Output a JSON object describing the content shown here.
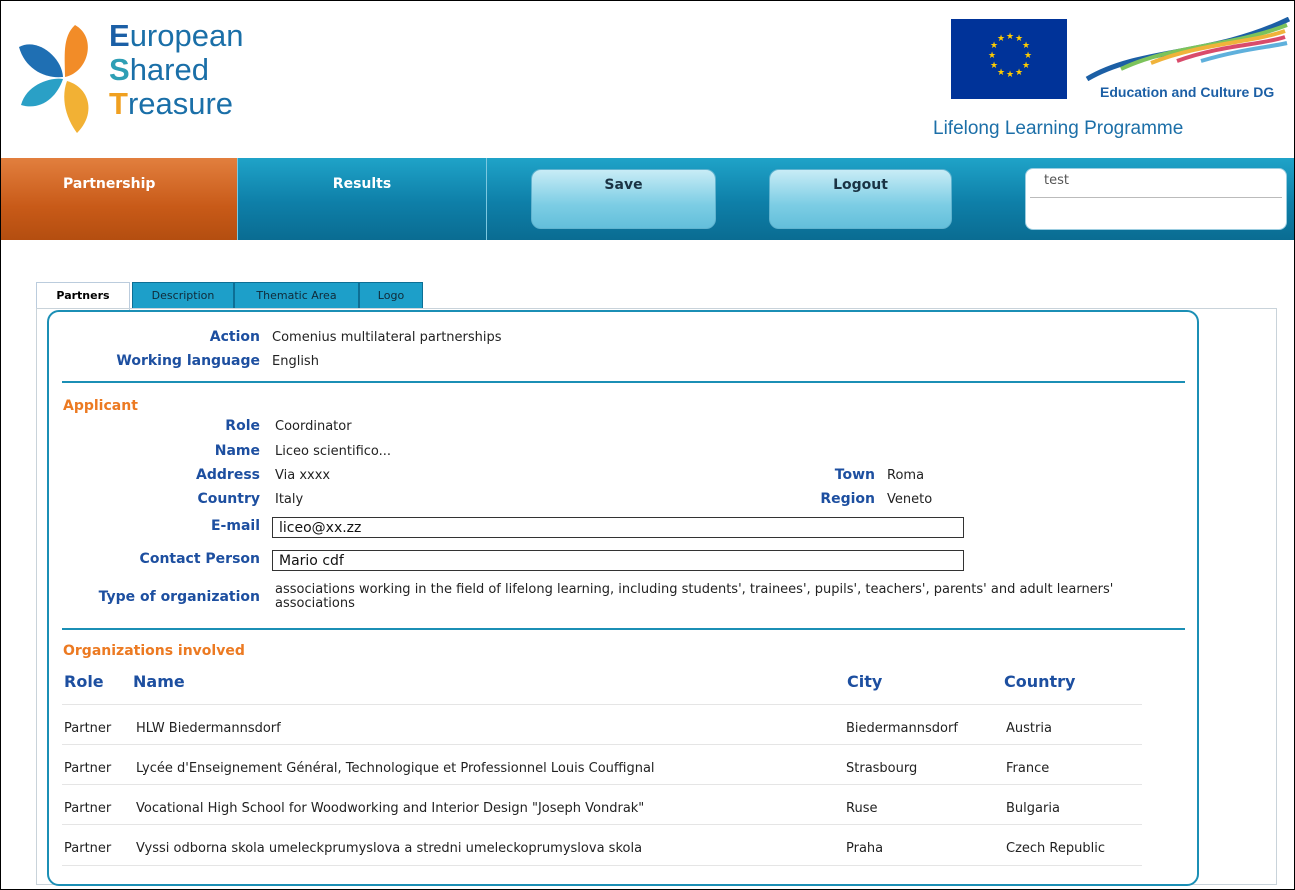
{
  "header": {
    "logo_words": [
      {
        "cap": "E",
        "rest": "uropean"
      },
      {
        "cap": "S",
        "rest": "hared"
      },
      {
        "cap": "T",
        "rest": "reasure"
      }
    ],
    "partner_name": "Education and Culture DG",
    "programme": "Lifelong Learning Programme"
  },
  "nav": {
    "partnership": "Partnership",
    "results": "Results",
    "save": "Save",
    "logout": "Logout",
    "user_value": "test"
  },
  "tabs": [
    "Partners",
    "Description",
    "Thematic Area",
    "Logo"
  ],
  "summary": {
    "action_label": "Action",
    "action_value": "Comenius multilateral partnerships",
    "language_label": "Working language",
    "language_value": "English"
  },
  "applicant": {
    "section_title": "Applicant",
    "role_label": "Role",
    "role_value": "Coordinator",
    "name_label": "Name",
    "name_value": "Liceo scientifico...",
    "address_label": "Address",
    "address_value": "Via xxxx",
    "town_label": "Town",
    "town_value": "Roma",
    "country_label": "Country",
    "country_value": "Italy",
    "region_label": "Region",
    "region_value": "Veneto",
    "email_label": "E-mail",
    "email_value": "liceo@xx.zz",
    "contact_label": "Contact Person",
    "contact_value": "Mario cdf",
    "type_label": "Type of organization",
    "type_value": "associations working in the field of lifelong learning, including students', trainees', pupils', teachers', parents' and adult learners' associations"
  },
  "organizations": {
    "section_title": "Organizations involved",
    "columns": [
      "Role",
      "Name",
      "City",
      "Country"
    ],
    "rows": [
      {
        "role": "Partner",
        "name": "HLW Biedermannsdorf",
        "city": "Biedermannsdorf",
        "country": "Austria"
      },
      {
        "role": "Partner",
        "name": "Lycée d'Enseignement Général, Technologique et Professionnel Louis Couffignal",
        "city": "Strasbourg",
        "country": "France"
      },
      {
        "role": "Partner",
        "name": "Vocational High School for Woodworking and Interior Design \"Joseph Vondrak\"",
        "city": "Ruse",
        "country": "Bulgaria"
      },
      {
        "role": "Partner",
        "name": "Vyssi odborna skola umeleckprumyslova a stredni umeleckoprumyslova skola",
        "city": "Praha",
        "country": "Czech Republic"
      }
    ]
  },
  "colors": {
    "brand_blue": "#1b8fb5",
    "accent_orange": "#ec7a22",
    "label_blue": "#1d4fa0"
  }
}
